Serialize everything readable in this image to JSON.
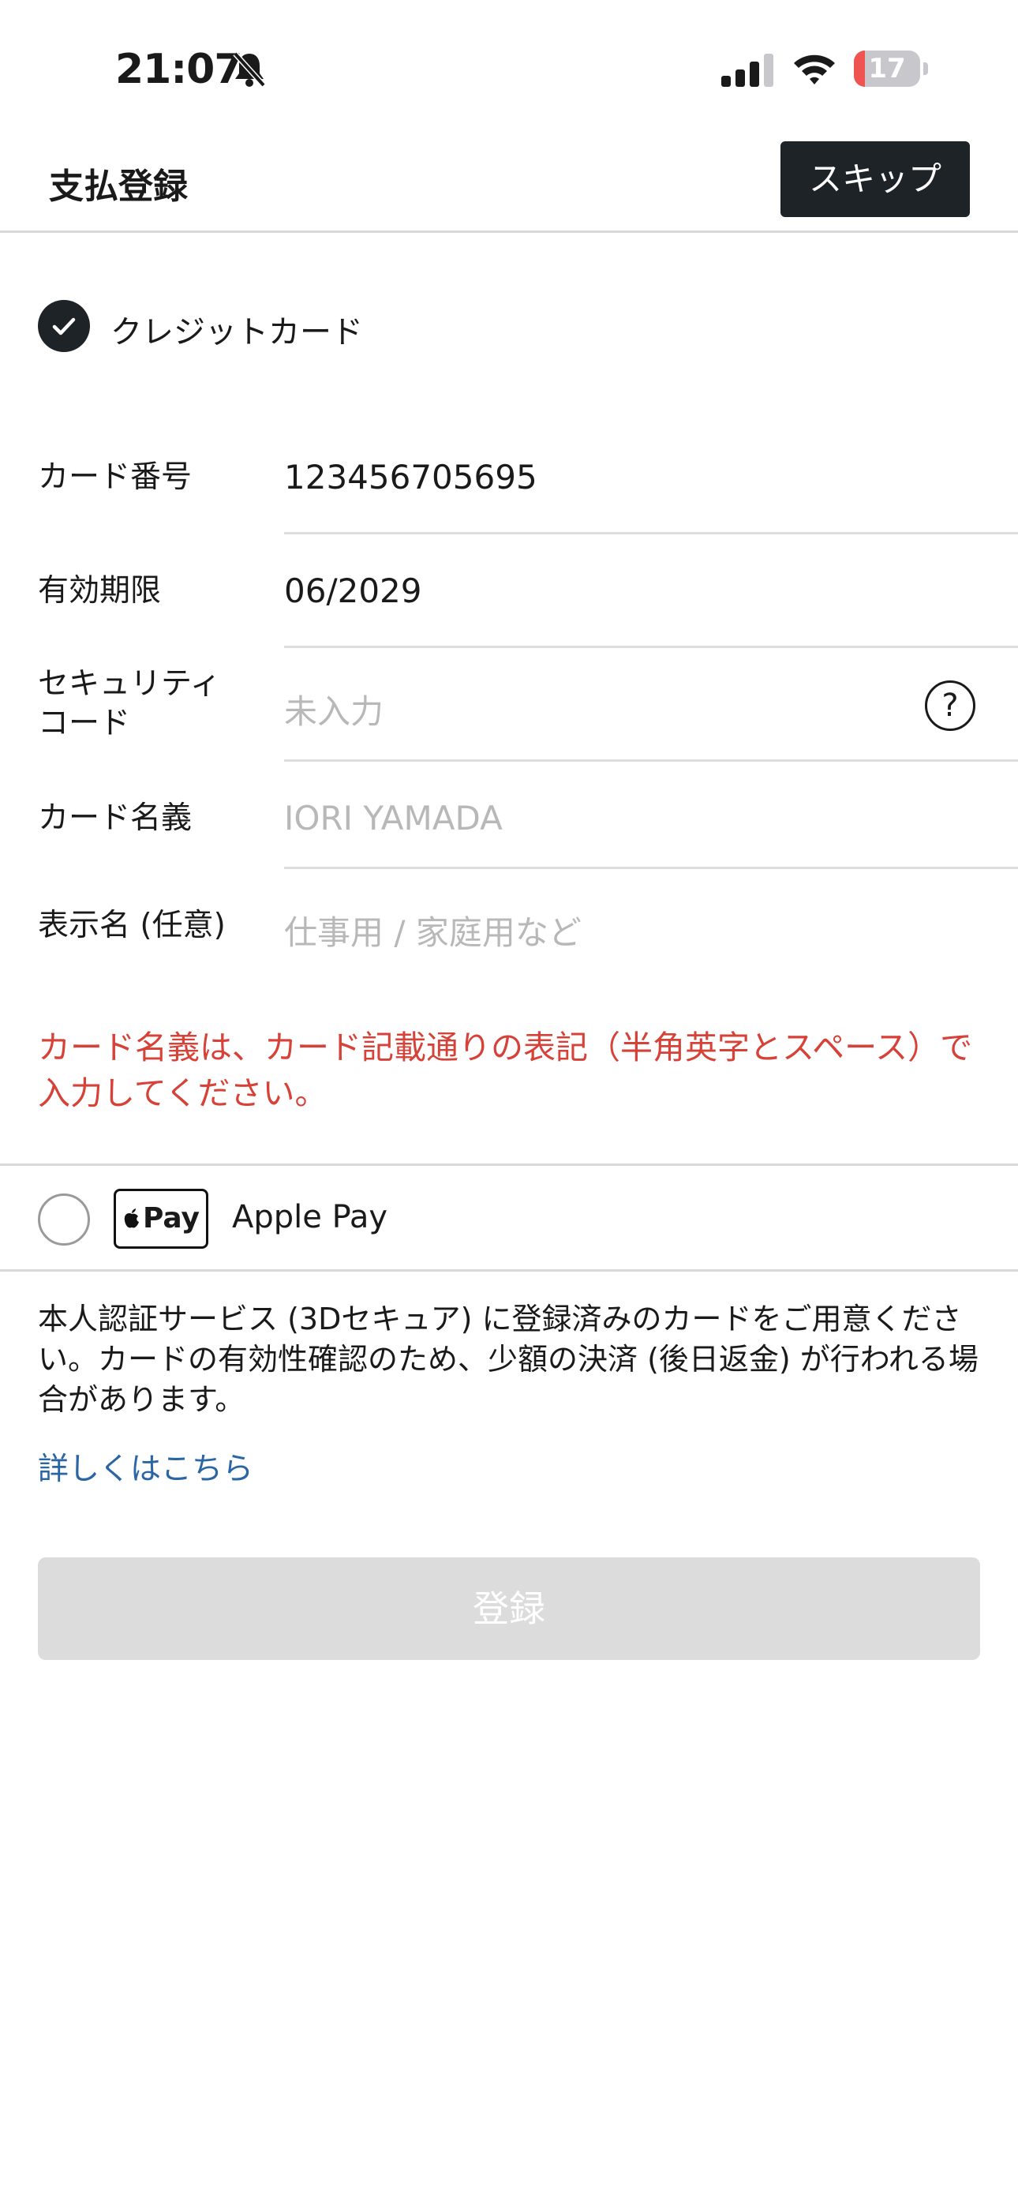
{
  "status_bar": {
    "time": "21:07",
    "battery_level": "17",
    "icons": [
      "bell-slash-icon",
      "cellular-signal-icon",
      "wifi-icon",
      "battery-icon"
    ]
  },
  "header": {
    "title": "支払登録",
    "skip_label": "スキップ"
  },
  "payment_methods": {
    "credit_card": {
      "label": "クレジットカード",
      "selected": true
    },
    "apple_pay": {
      "badge": "Pay",
      "label": "Apple Pay",
      "selected": false
    }
  },
  "form": {
    "card_number": {
      "label": "カード番号",
      "value": "123456705695"
    },
    "expiry": {
      "label": "有効期限",
      "value": "06/2029"
    },
    "security_code": {
      "label_line1": "セキュリティ",
      "label_line2": "コード",
      "placeholder": "未入力",
      "help": "?"
    },
    "card_holder": {
      "label": "カード名義",
      "placeholder": "IORI YAMADA"
    },
    "display_name": {
      "label": "表示名 (任意)",
      "placeholder": "仕事用 / 家庭用など"
    }
  },
  "error_message": "カード名義は、カード記載通りの表記（半角英字とスペース）で入力してください。",
  "notice": "本人認証サービス (3Dセキュア) に登録済みのカードをご用意ください。カードの有効性確認のため、少額の決済 (後日返金) が行われる場合があります。",
  "more_link": "詳しくはこちら",
  "register_label": "登録",
  "colors": {
    "dark_button": "#1e2328",
    "error": "#d64138",
    "link": "#2a66a4",
    "disabled_button": "#dcdcdc",
    "battery_low": "#f05451"
  }
}
